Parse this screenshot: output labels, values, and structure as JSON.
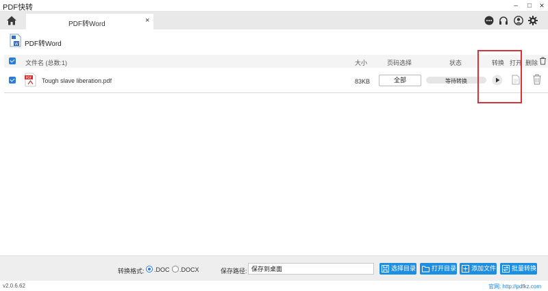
{
  "window": {
    "title": "PDF快转",
    "minimize": "–",
    "maximize": "□",
    "close": "×"
  },
  "tabs": [
    {
      "label": "PDF转Word",
      "close": "×"
    }
  ],
  "header": {
    "title": "PDF转Word"
  },
  "table": {
    "columns": {
      "filename": "文件名 (总数:1)",
      "size": "大小",
      "pages": "页码选择",
      "status": "状态",
      "convert": "转换",
      "open": "打开",
      "delete": "删除"
    },
    "rows": [
      {
        "checked": true,
        "filename": "Tough slave liberation.pdf",
        "size": "83KB",
        "pages": "全部",
        "status": "等待转换",
        "progress": 0
      }
    ]
  },
  "bottom": {
    "format_label": "转换格式:",
    "formats": [
      {
        "label": ".DOC",
        "selected": true
      },
      {
        "label": ".DOCX",
        "selected": false
      }
    ],
    "path_label": "保存路径:",
    "path_value": "保存到桌面",
    "buttons": {
      "choose_dir": "选择目录",
      "open_dir": "打开目录",
      "add_file": "添加文件",
      "batch_convert": "批量转换"
    }
  },
  "statusbar": {
    "version": "v2.0.6.62",
    "website": "官网:  http://pdfkz.com"
  },
  "colors": {
    "accent": "#1e8fe0",
    "highlight": "#d9303a",
    "checkbox": "#2b7cd9"
  }
}
